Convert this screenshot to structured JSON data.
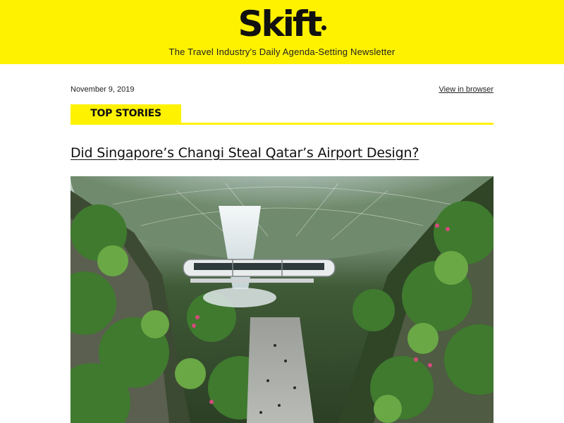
{
  "header": {
    "logo_text": "Skift",
    "tagline": "The Travel Industry's Daily Agenda-Setting Newsletter",
    "brand_color": "#fff200"
  },
  "meta": {
    "date": "November 9, 2019",
    "view_in_browser": "View in browser"
  },
  "section": {
    "label": "TOP STORIES"
  },
  "story": {
    "headline": "Did Singapore’s Changi Steal Qatar’s Airport Design?",
    "image_icon": "photo-of-indoor-waterfall-garden"
  }
}
